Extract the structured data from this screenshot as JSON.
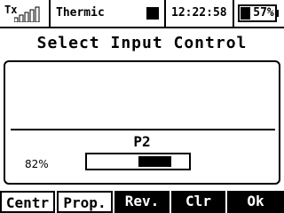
{
  "status": {
    "tx_label": "Tx",
    "signal_bars": 5,
    "model_name": "Thermic",
    "clock": "12:22:58",
    "battery_text": "57%",
    "battery_level": 0.57
  },
  "title": "Select Input Control",
  "input": {
    "name": "P2",
    "percent_label": "82%",
    "bar_level": 0.82
  },
  "buttons": [
    {
      "label": "Centr",
      "style": "light"
    },
    {
      "label": "Prop.",
      "style": "light"
    },
    {
      "label": "Rev.",
      "style": "dark"
    },
    {
      "label": "Clr",
      "style": "dark"
    },
    {
      "label": "Ok",
      "style": "dark"
    }
  ]
}
